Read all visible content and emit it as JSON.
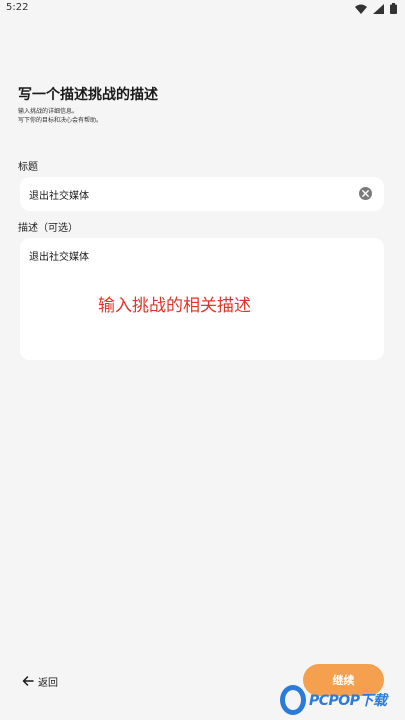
{
  "status_bar": {
    "time": "5:22",
    "icons": [
      "wifi-icon",
      "signal-icon",
      "battery-icon"
    ]
  },
  "header": {
    "title": "写一个描述挑战的描述",
    "subtitle_line1": "输入挑战的详细信息。",
    "subtitle_line2": "写下你的目标和决心会有帮助。"
  },
  "form": {
    "title_label": "标题",
    "title_value": "退出社交媒体",
    "description_label": "描述（可选）",
    "description_value": "退出社交媒体",
    "description_overlay": "输入挑战的相关描述"
  },
  "nav": {
    "back_label": "返回",
    "continue_label": "继续"
  },
  "watermark": {
    "text": "PCPOP下载"
  },
  "colors": {
    "background": "#f5f5f5",
    "card": "#ffffff",
    "accent": "#f5a04e",
    "annotation": "#e0342a",
    "watermark": "#2b7bd9"
  }
}
